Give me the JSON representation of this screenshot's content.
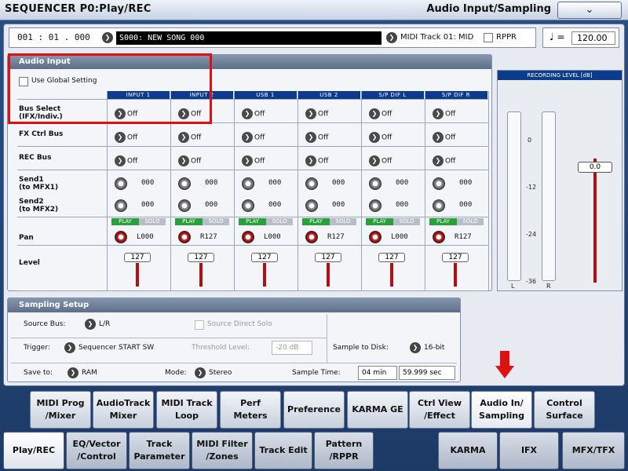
{
  "header": {
    "mode": "SEQUENCER P0:Play/REC",
    "page": "Audio Input/Sampling",
    "menu_icon": "chevron-down-icon",
    "menu_glyph": "⌄"
  },
  "songbar": {
    "locator": "001 : 01 . 000",
    "song": "S000: NEW SONG 000",
    "midi_track": "MIDI Track 01: MID",
    "rppr_label": "RPPR",
    "tempo_note": "♩ =",
    "tempo": "120.00"
  },
  "audio_input": {
    "title": "Audio Input",
    "use_global": "Use Global Setting",
    "columns": [
      "INPUT 1",
      "INPUT 2",
      "USB 1",
      "USB 2",
      "S/P DIF L",
      "S/P DIF R"
    ],
    "rows": {
      "bus_select": "Bus Select\n(IFX/Indiv.)",
      "fx_ctrl_bus": "FX Ctrl Bus",
      "rec_bus": "REC Bus",
      "send1": "Send1\n(to MFX1)",
      "send2": "Send2\n(to MFX2)",
      "pan": "Pan",
      "level": "Level"
    },
    "off_label": "Off",
    "send1_values": [
      "000",
      "000",
      "000",
      "000",
      "000",
      "000"
    ],
    "send2_values": [
      "000",
      "000",
      "000",
      "000",
      "000",
      "000"
    ],
    "play_label": "PLAY",
    "solo_label": "SOLO",
    "pan_values": [
      "L000",
      "R127",
      "L000",
      "R127",
      "L000",
      "R127"
    ],
    "level_values": [
      "127",
      "127",
      "127",
      "127",
      "127",
      "127"
    ]
  },
  "recording_level": {
    "title": "RECORDING LEVEL [dB]",
    "ticks": [
      "0",
      "-12",
      "-24",
      "-36"
    ],
    "left_label": "L",
    "right_label": "R",
    "fader_value": "0.0"
  },
  "sampling_setup": {
    "title": "Sampling Setup",
    "source_bus_label": "Source Bus:",
    "source_bus": "L/R",
    "source_direct_solo": "Source Direct Solo",
    "trigger_label": "Trigger:",
    "trigger": "Sequencer START SW",
    "threshold_label": "Threshold Level:",
    "threshold": "-20 dB",
    "sample_to_disk_label": "Sample to Disk:",
    "sample_to_disk": "16-bit",
    "save_to_label": "Save to:",
    "save_to": "RAM",
    "mode_label": "Mode:",
    "mode": "Stereo",
    "sample_time_label": "Sample Time:",
    "sample_time_min": "04 min",
    "sample_time_sec": "59.999 sec"
  },
  "tabs_top": [
    "MIDI Prog\n/Mixer",
    "AudioTrack\nMixer",
    "MIDI Track\nLoop",
    "Perf\nMeters",
    "Preference",
    "KARMA GE",
    "Ctrl View\n/Effect",
    "Audio In/\nSampling",
    "Control\nSurface"
  ],
  "tabs_bottom": [
    "Play/REC",
    "EQ/Vector\n/Control",
    "Track\nParameter",
    "MIDI Filter\n/Zones",
    "Track Edit",
    "Pattern\n/RPPR",
    "KARMA",
    "IFX",
    "MFX/TFX"
  ],
  "colors": {
    "highlight": "#e01010",
    "header_blue": "#0d3b8c",
    "fader_red": "#b01010",
    "play_green": "#2aa03a"
  }
}
